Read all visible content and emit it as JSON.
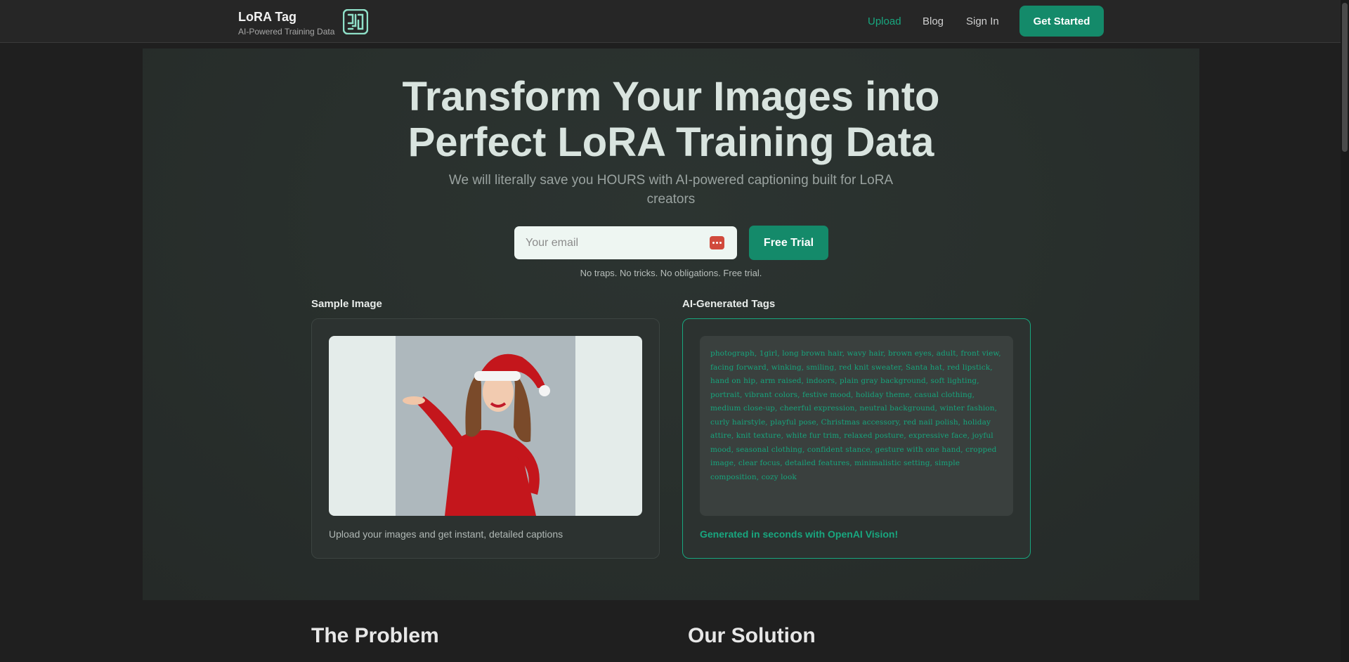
{
  "nav": {
    "brand_title": "LoRA Tag",
    "brand_subtitle": "AI-Powered Training Data",
    "logo_icon": "maze-logo-icon",
    "links": [
      "Upload",
      "Blog",
      "Sign In"
    ],
    "active_link": "Upload",
    "cta_label": "Get Started"
  },
  "hero": {
    "headline_line1": "Transform Your Images into",
    "headline_line2": "Perfect LoRA Training Data",
    "subline": "We will literally save you HOURS with AI-powered captioning built for LoRA creators",
    "email_placeholder": "Your email",
    "email_value": "",
    "password_manager_icon": "password-manager-icon",
    "trial_button": "Free Trial",
    "note": "No traps. No tricks. No obligations. Free trial."
  },
  "sample": {
    "title": "Sample Image",
    "image_alt": "woman-santa-hat-red-sweater-photo",
    "caption": "Upload your images and get instant, detailed captions"
  },
  "tags": {
    "title": "AI-Generated Tags",
    "text": "photograph, 1girl, long brown hair, wavy hair, brown eyes, adult, front view, facing forward, winking, smiling, red knit sweater, Santa hat, red lipstick, hand on hip, arm raised, indoors, plain gray background, soft lighting, portrait, vibrant colors, festive mood, holiday theme, casual clothing, medium close-up, cheerful expression, neutral background, winter fashion, curly hairstyle, playful pose, Christmas accessory, red nail polish, holiday attire, knit texture, white fur trim, relaxed posture, expressive face, joyful mood, seasonal clothing, confident stance, gesture with one hand, cropped image, clear focus, detailed features, minimalistic setting, simple composition, cozy look",
    "footer": "Generated in seconds with OpenAI Vision!"
  },
  "sections": {
    "problem_title": "The Problem",
    "solution_title": "Our Solution"
  },
  "colors": {
    "accent": "#148a6a",
    "accent_text": "#18a77f",
    "background": "#1f1f1f",
    "hero_background": "#29302d"
  }
}
